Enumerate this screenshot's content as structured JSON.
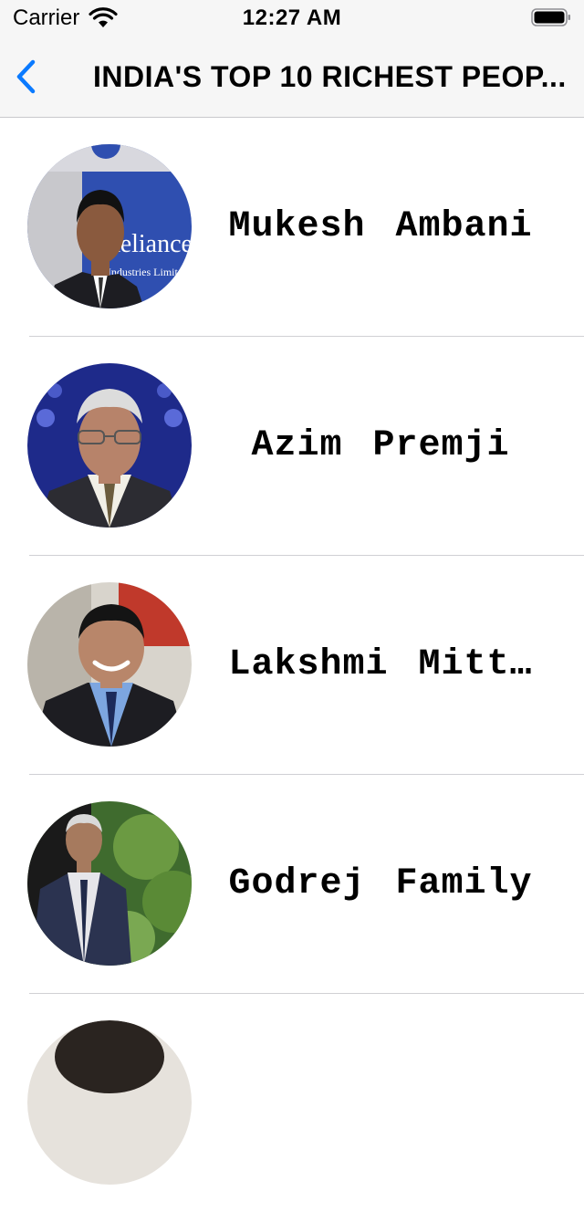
{
  "status_bar": {
    "carrier": "Carrier",
    "time": "12:27 AM"
  },
  "nav": {
    "title": "INDIA'S TOP 10 RICHEST PEOP..."
  },
  "list": {
    "items": [
      {
        "name": "Mukesh  Ambani",
        "icon": "person-photo"
      },
      {
        "name": "Azim  Premji",
        "icon": "person-photo"
      },
      {
        "name": "Lakshmi  Mitt…",
        "icon": "person-photo"
      },
      {
        "name": "Godrej  Family",
        "icon": "person-photo"
      },
      {
        "name": "",
        "icon": "person-photo"
      }
    ],
    "avatar_texts": {
      "reliance": "Reliance",
      "reliance_sub": "Industries Limited"
    }
  },
  "colors": {
    "accent": "#0a7aff",
    "bar_background": "#f6f6f6",
    "separator": "#d0d0d4"
  }
}
